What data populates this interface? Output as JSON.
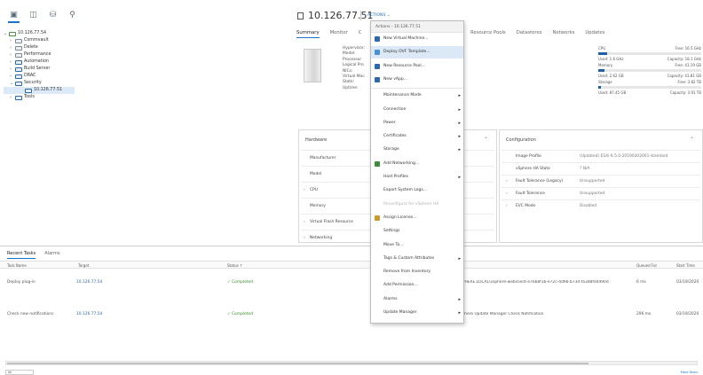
{
  "navigator": {
    "tabs": [
      {
        "icon": "hosts-clusters-icon",
        "active": true
      },
      {
        "icon": "vms-templates-icon",
        "active": false
      },
      {
        "icon": "storage-icon",
        "active": false
      },
      {
        "icon": "networking-icon",
        "active": false
      }
    ],
    "tree": [
      {
        "label": "10.126.77.54",
        "indent": 0,
        "toggle": "⌄",
        "kind": "vcenter"
      },
      {
        "label": "Commvault",
        "indent": 1,
        "toggle": "›",
        "kind": "folder"
      },
      {
        "label": "Delete",
        "indent": 1,
        "toggle": "›",
        "kind": "folder"
      },
      {
        "label": "Performance",
        "indent": 1,
        "toggle": "›",
        "kind": "folder"
      },
      {
        "label": "Automation",
        "indent": 1,
        "toggle": "›",
        "kind": "host"
      },
      {
        "label": "Build Server",
        "indent": 1,
        "toggle": "›",
        "kind": "host"
      },
      {
        "label": "DRAC",
        "indent": 1,
        "toggle": "›",
        "kind": "host"
      },
      {
        "label": "Security",
        "indent": 1,
        "toggle": "⌄",
        "kind": "host"
      },
      {
        "label": "10.126.77.51",
        "indent": 2,
        "toggle": "",
        "kind": "host",
        "selected": true
      },
      {
        "label": "Tools",
        "indent": 1,
        "toggle": "›",
        "kind": "host"
      }
    ]
  },
  "header": {
    "title": "10.126.77.51",
    "actions_label": "ACTIONS ⌄"
  },
  "tabs": [
    "Summary",
    "Monitor",
    "C"
  ],
  "tabs_right": [
    "Resource Pools",
    "Datastores",
    "Networks",
    "Updates"
  ],
  "summary": {
    "lines": [
      "Hypervisor:",
      "Model:",
      "Processor",
      "Logical Pro",
      "NICs:",
      "Virtual Mac",
      "State:",
      "Uptime:"
    ],
    "hw_partial": "@ 2.90GHz"
  },
  "stats": [
    {
      "label": "CPU",
      "free": "Free: 16.5 GHz",
      "used": "Used: 1.6 GHz",
      "capacity": "Capacity: 18.1 GHz",
      "fill": 0.09
    },
    {
      "label": "Memory",
      "free": "Free: 41.19 GB",
      "used": "Used: 2.62 GB",
      "capacity": "Capacity: 43.81 GB",
      "fill": 0.06
    },
    {
      "label": "Storage",
      "free": "Free: 3.82 TB",
      "used": "Used: 87.45 GB",
      "capacity": "Capacity: 3.91 TB",
      "fill": 0.02
    }
  ],
  "hardware": {
    "title": "Hardware",
    "rows": [
      {
        "toggle": "",
        "label": "Manufacturer"
      },
      {
        "toggle": "",
        "label": "Model"
      },
      {
        "toggle": "›",
        "label": "CPU"
      },
      {
        "toggle": "",
        "label": "Memory"
      },
      {
        "toggle": "›",
        "label": "Virtual Flash Resource"
      },
      {
        "toggle": "›",
        "label": "Networking"
      },
      {
        "toggle": "",
        "label": "Storage"
      }
    ]
  },
  "configuration": {
    "title": "Configuration",
    "rows": [
      {
        "toggle": "",
        "key": "Image Profile",
        "value": "(Updated) ESXi-6.5.0-20190302001-standard"
      },
      {
        "toggle": "",
        "key": "vSphere HA State",
        "value": "?  N/A"
      },
      {
        "toggle": "›",
        "key": "Fault Tolerance (Legacy)",
        "value": "Unsupported"
      },
      {
        "toggle": "›",
        "key": "Fault Tolerance",
        "value": "Unsupported"
      },
      {
        "toggle": "›",
        "key": "EVC Mode",
        "value": "Disabled"
      }
    ]
  },
  "menu": {
    "title": "Actions - 10.126.77.51",
    "items": [
      {
        "label": "New Virtual Machine...",
        "icon": "new-vm-icon",
        "color": "#2f6aa8",
        "arrow": false,
        "disabled": false,
        "highlight": false
      },
      {
        "label": "Deploy OVF Template...",
        "icon": "deploy-ovf-icon",
        "color": "#4a8fd0",
        "arrow": false,
        "disabled": false,
        "highlight": true
      },
      {
        "label": "New Resource Pool...",
        "icon": "resource-pool-icon",
        "color": "#2f6aa8",
        "arrow": false,
        "disabled": false,
        "highlight": false
      },
      {
        "label": "New vApp...",
        "icon": "vapp-icon",
        "color": "#2f6aa8",
        "arrow": false,
        "disabled": false,
        "highlight": false
      },
      {
        "divider": true
      },
      {
        "label": "Maintenance Mode",
        "arrow": true,
        "disabled": false,
        "highlight": false
      },
      {
        "label": "Connection",
        "arrow": true,
        "disabled": false,
        "highlight": false
      },
      {
        "label": "Power",
        "arrow": true,
        "disabled": false,
        "highlight": false
      },
      {
        "label": "Certificates",
        "arrow": true,
        "disabled": false,
        "highlight": false
      },
      {
        "label": "Storage",
        "arrow": true,
        "disabled": false,
        "highlight": false
      },
      {
        "label": "Add Networking...",
        "icon": "add-networking-icon",
        "color": "#3f8a3a",
        "arrow": false,
        "disabled": false,
        "highlight": false
      },
      {
        "label": "Host Profiles",
        "arrow": true,
        "disabled": false,
        "highlight": false
      },
      {
        "label": "Export System Logs...",
        "arrow": false,
        "disabled": false,
        "highlight": false
      },
      {
        "label": "Reconfigure for vSphere HA",
        "arrow": false,
        "disabled": true,
        "highlight": false
      },
      {
        "label": "Assign License...",
        "icon": "license-icon",
        "color": "#c99a2e",
        "arrow": false,
        "disabled": false,
        "highlight": false
      },
      {
        "label": "Settings",
        "arrow": false,
        "disabled": false,
        "highlight": false
      },
      {
        "label": "Move To...",
        "arrow": false,
        "disabled": false,
        "highlight": false
      },
      {
        "label": "Tags & Custom Attributes",
        "arrow": true,
        "disabled": false,
        "highlight": false
      },
      {
        "label": "Remove from Inventory",
        "arrow": false,
        "disabled": false,
        "highlight": false
      },
      {
        "label": "Add Permission...",
        "arrow": false,
        "disabled": false,
        "highlight": false
      },
      {
        "label": "Alarms",
        "arrow": true,
        "disabled": false,
        "highlight": false
      },
      {
        "label": "Update Manager",
        "arrow": true,
        "disabled": false,
        "highlight": false
      }
    ]
  },
  "tasks": {
    "tabs": [
      "Recent Tasks",
      "Alarms"
    ],
    "columns": {
      "task_name": "Task Name",
      "target": "Target",
      "status": "Status ↑",
      "queued_for": "Queued For",
      "start_time": "Start Time"
    },
    "rows": [
      {
        "task_name": "Deploy plug-in",
        "target": "10.126.77.54",
        "status": "✓ Completed",
        "details": "VSPHERE.LOCAL\\vsphere-webclient-e76b8f1b-e72c-4d9b-b73d-fa3d8fd4d90d",
        "queued_for": "6 ms",
        "start_time": "03/19/2020"
      },
      {
        "task_name": "Check new notifications",
        "target": "10.126.77.54",
        "status": "✓ Completed",
        "details": "vSphere Update Manager Check Notification",
        "queued_for": "296 ms",
        "start_time": "03/19/2020"
      }
    ],
    "footer_select": "All",
    "footer_more": "More Tasks"
  },
  "colors": {
    "accent": "#1a73c9",
    "ok": "#3d8b2e",
    "bar": "#1f5fa6"
  }
}
